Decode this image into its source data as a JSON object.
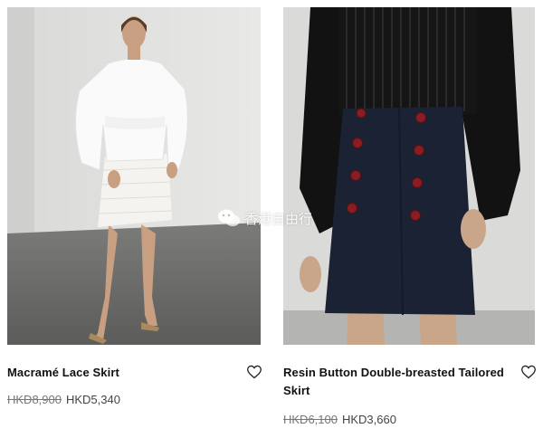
{
  "products": [
    {
      "name": "Macramé Lace Skirt",
      "old_price": "HKD8,900",
      "price": "HKD5,340",
      "image_icon": "product-photo-white-lace-skirt"
    },
    {
      "name": "Resin Button Double-breasted Tailored Skirt",
      "old_price": "HKD6,100",
      "price": "HKD3,660",
      "image_icon": "product-photo-navy-button-skirt"
    }
  ],
  "wishlist_icon": "heart-icon",
  "watermark": {
    "text": "香港自由行",
    "icon": "wechat-icon"
  },
  "colors": {
    "title": "#111111",
    "price": "#444444",
    "strikethrough": "#777777"
  }
}
